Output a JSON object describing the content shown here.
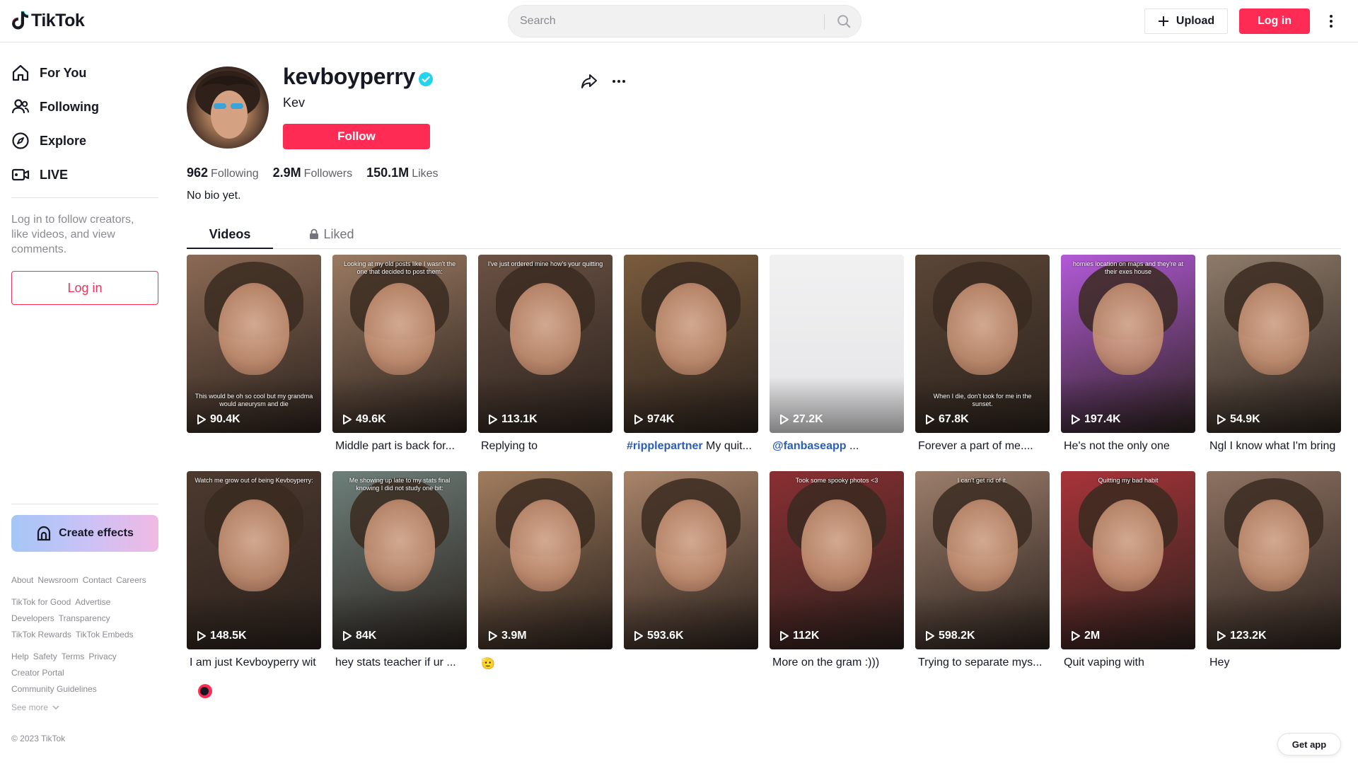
{
  "header": {
    "logo_text": "TikTok",
    "search_placeholder": "Search",
    "upload_label": "Upload",
    "login_label": "Log in"
  },
  "sidebar": {
    "nav": [
      {
        "label": "For You",
        "icon": "home-icon"
      },
      {
        "label": "Following",
        "icon": "following-icon"
      },
      {
        "label": "Explore",
        "icon": "compass-icon"
      },
      {
        "label": "LIVE",
        "icon": "live-icon"
      }
    ],
    "hint": "Log in to follow creators, like videos, and view comments.",
    "login_label": "Log in",
    "create_effects_label": "Create effects",
    "footer_rows": [
      [
        "About",
        "Newsroom",
        "Contact",
        "Careers"
      ],
      [
        "TikTok for Good",
        "Advertise"
      ],
      [
        "Developers",
        "Transparency"
      ],
      [
        "TikTok Rewards",
        "TikTok Embeds"
      ],
      [
        "Help",
        "Safety",
        "Terms",
        "Privacy"
      ],
      [
        "Creator Portal"
      ],
      [
        "Community Guidelines"
      ]
    ],
    "see_more": "See more",
    "copyright": "© 2023 TikTok"
  },
  "profile": {
    "username": "kevboyperry",
    "nickname": "Kev",
    "verified": true,
    "follow_label": "Follow",
    "stats": {
      "following_count": "962",
      "following_label": "Following",
      "followers_count": "2.9M",
      "followers_label": "Followers",
      "likes_count": "150.1M",
      "likes_label": "Likes"
    },
    "bio": "No bio yet."
  },
  "tabs": {
    "videos": "Videos",
    "liked": "Liked"
  },
  "videos": [
    {
      "views": "90.4K",
      "caption": "",
      "overlay": "This would be oh so cool but my grandma would aneurysm and die",
      "tone": "#8b6a55"
    },
    {
      "views": "49.6K",
      "caption": "Middle part is back for...",
      "overlay": "Looking at my old posts like I wasn't the one that decided to post them:",
      "tone": "#9a7a62"
    },
    {
      "views": "113.1K",
      "caption": "Replying to",
      "overlay": "I've just ordered mine how's your quitting",
      "tone": "#6b5244"
    },
    {
      "views": "974K",
      "caption_tag": "#ripplepartner",
      "caption": " My quit...",
      "overlay": "",
      "tone": "#7a5c3e"
    },
    {
      "views": "27.2K",
      "caption_tag": "@fanbaseapp",
      "caption": " ...",
      "overlay": "",
      "tone": "#f1f1f2"
    },
    {
      "views": "67.8K",
      "caption": "Forever a part of me....",
      "overlay": "When I die, don't look for me in the sunset.",
      "tone": "#5b4636"
    },
    {
      "views": "197.4K",
      "caption": "He's not the only one",
      "overlay": "homies location on maps and they're at their exes house",
      "tone": "#b35ad8"
    },
    {
      "views": "54.9K",
      "caption": "Ngl I know what I'm bring",
      "overlay": "",
      "tone": "#8e7b6a"
    },
    {
      "views": "148.5K",
      "caption": "I am just Kevboyperry wit",
      "overlay": "Watch me grow out of being Kevboyperry:",
      "tone": "#4d3a2f"
    },
    {
      "views": "84K",
      "caption": "hey stats teacher if ur ...",
      "overlay": "Me showing up late to my stats final knowing I did not study one bit:",
      "tone": "#6e7f7a"
    },
    {
      "views": "3.9M",
      "caption": "🫡",
      "overlay": "",
      "tone": "#a07c5e"
    },
    {
      "views": "593.6K",
      "caption": "",
      "overlay": "",
      "tone": "#a9846a"
    },
    {
      "views": "112K",
      "caption": "More on the gram :)))",
      "overlay": "Took some spooky photos <3",
      "tone": "#8a2f33"
    },
    {
      "views": "598.2K",
      "caption": "Trying to separate mys...",
      "overlay": "I can't get rid of it.",
      "tone": "#9c7e6c"
    },
    {
      "views": "2M",
      "caption": "Quit vaping with",
      "overlay": "Quitting my bad habit",
      "tone": "#a8343a"
    },
    {
      "views": "123.2K",
      "caption": "Hey",
      "overlay": "",
      "tone": "#8d7262"
    }
  ],
  "get_app_label": "Get app",
  "colors": {
    "brand": "#fe2c55",
    "verified": "#20d5ec",
    "text": "#161823",
    "muted": "#8a8b91"
  }
}
